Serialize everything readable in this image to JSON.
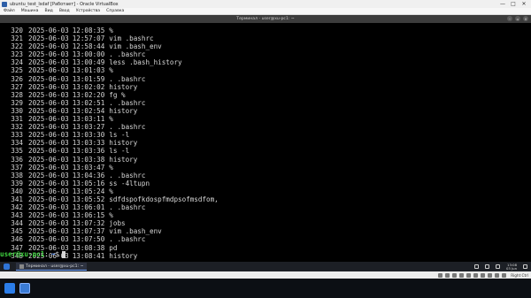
{
  "window": {
    "title": "ubuntu_test_lsdaf [Работает] - Oracle VirtualBox",
    "controls": [
      "—",
      "□",
      "✕"
    ]
  },
  "menubar": [
    "Файл",
    "Машина",
    "Вид",
    "Ввод",
    "Устройства",
    "Справка"
  ],
  "terminal": {
    "title": "Терминал - user@xu-pc1: ~",
    "history": [
      {
        "num": "320",
        "date": "2025-06-03",
        "time": "12:08:35",
        "cmd": "%"
      },
      {
        "num": "321",
        "date": "2025-06-03",
        "time": "12:57:07",
        "cmd": "vim .bashrc"
      },
      {
        "num": "322",
        "date": "2025-06-03",
        "time": "12:58:44",
        "cmd": "vim .bash_env"
      },
      {
        "num": "323",
        "date": "2025-06-03",
        "time": "13:00:00",
        "cmd": ". .bashrc"
      },
      {
        "num": "324",
        "date": "2025-06-03",
        "time": "13:00:49",
        "cmd": "less .bash_history"
      },
      {
        "num": "325",
        "date": "2025-06-03",
        "time": "13:01:03",
        "cmd": "%"
      },
      {
        "num": "326",
        "date": "2025-06-03",
        "time": "13:01:59",
        "cmd": ". .bashrc"
      },
      {
        "num": "327",
        "date": "2025-06-03",
        "time": "13:02:02",
        "cmd": "history"
      },
      {
        "num": "328",
        "date": "2025-06-03",
        "time": "13:02:20",
        "cmd": "fg %"
      },
      {
        "num": "329",
        "date": "2025-06-03",
        "time": "13:02:51",
        "cmd": ". .bashrc"
      },
      {
        "num": "330",
        "date": "2025-06-03",
        "time": "13:02:54",
        "cmd": "history"
      },
      {
        "num": "331",
        "date": "2025-06-03",
        "time": "13:03:11",
        "cmd": "%"
      },
      {
        "num": "332",
        "date": "2025-06-03",
        "time": "13:03:27",
        "cmd": ". .bashrc"
      },
      {
        "num": "333",
        "date": "2025-06-03",
        "time": "13:03:30",
        "cmd": "ls -l"
      },
      {
        "num": "334",
        "date": "2025-06-03",
        "time": "13:03:33",
        "cmd": "history"
      },
      {
        "num": "335",
        "date": "2025-06-03",
        "time": "13:03:36",
        "cmd": "ls -l"
      },
      {
        "num": "336",
        "date": "2025-06-03",
        "time": "13:03:38",
        "cmd": "history"
      },
      {
        "num": "337",
        "date": "2025-06-03",
        "time": "13:03:47",
        "cmd": "%"
      },
      {
        "num": "338",
        "date": "2025-06-03",
        "time": "13:04:36",
        "cmd": ". .bashrc"
      },
      {
        "num": "339",
        "date": "2025-06-03",
        "time": "13:05:16",
        "cmd": "ss -4ltupn"
      },
      {
        "num": "340",
        "date": "2025-06-03",
        "time": "13:05:24",
        "cmd": "%"
      },
      {
        "num": "341",
        "date": "2025-06-03",
        "time": "13:05:52",
        "cmd": "sdfdspofkdospfmdpsofmsdfom,"
      },
      {
        "num": "342",
        "date": "2025-06-03",
        "time": "13:06:01",
        "cmd": ". .bashrc"
      },
      {
        "num": "343",
        "date": "2025-06-03",
        "time": "13:06:15",
        "cmd": "%"
      },
      {
        "num": "344",
        "date": "2025-06-03",
        "time": "13:07:32",
        "cmd": "jobs"
      },
      {
        "num": "345",
        "date": "2025-06-03",
        "time": "13:07:37",
        "cmd": "vim .bash_env"
      },
      {
        "num": "346",
        "date": "2025-06-03",
        "time": "13:07:50",
        "cmd": ". .bashrc"
      },
      {
        "num": "347",
        "date": "2025-06-03",
        "time": "13:08:38",
        "cmd": "pd"
      },
      {
        "num": "348",
        "date": "2025-06-03",
        "time": "13:08:41",
        "cmd": "history"
      }
    ],
    "prompt": {
      "user": "user@xu-pc1",
      "sep": ":",
      "path": "~",
      "dollar": "$"
    }
  },
  "guest_taskbar": {
    "task_label": "Терминал - user@xu-pc1: ~",
    "clock_time": "13:08",
    "clock_date": "03 Jun"
  },
  "colors": {
    "prompt_user": "#3fd33f",
    "prompt_path": "#4f8fff",
    "terminal_bg": "#000000",
    "terminal_fg": "#d8d8d8"
  },
  "host_status": {
    "host_key": "Right Ctrl"
  }
}
